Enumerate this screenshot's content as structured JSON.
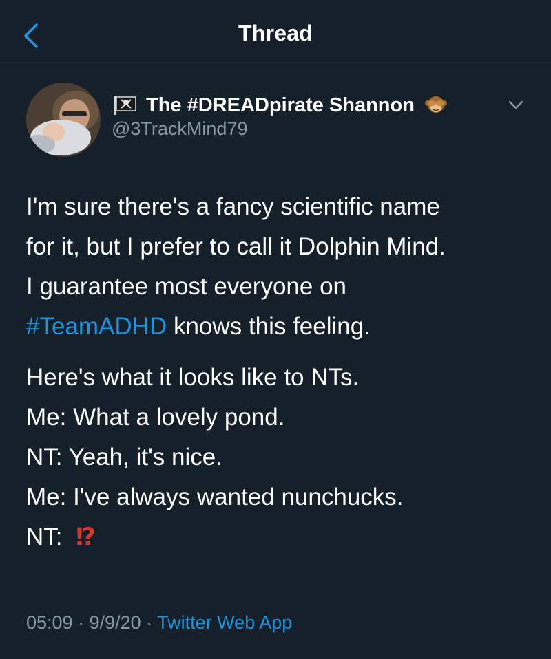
{
  "nav": {
    "title": "Thread",
    "back_icon": "chevron-left-icon"
  },
  "tweet": {
    "display_name": "The #DREADpirate Shannon",
    "handle": "@3TrackMind79",
    "name_prefix_icon": "pirate-flag-icon",
    "name_suffix_icon": "see-no-evil-monkey-icon",
    "more_icon": "chevron-down-icon",
    "body": {
      "p1_line1": "I'm sure there's a fancy scientific name",
      "p1_line2": "for it, but I prefer to call it Dolphin Mind.",
      "p1_line3": "I guarantee most everyone on",
      "p1_hashtag": "#TeamADHD",
      "p1_line4_rest": " knows this feeling.",
      "p2_line1": "Here's what it looks like to NTs.",
      "p2_line2": "Me: What a lovely pond.",
      "p2_line3": "NT: Yeah, it's nice.",
      "p2_line4": "Me: I've always wanted nunchucks.",
      "p2_line5_prefix": "NT: ",
      "p2_line5_emoji": "⁉"
    },
    "meta": {
      "time": "05:09",
      "sep1": " · ",
      "date": "9/9/20",
      "sep2": " · ",
      "source": "Twitter Web App"
    }
  },
  "colors": {
    "background": "#15202b",
    "text": "#ffffff",
    "secondary": "#8899a6",
    "link": "#1b95e0",
    "divider": "#38444d",
    "interrobang": "#d13a2b"
  }
}
